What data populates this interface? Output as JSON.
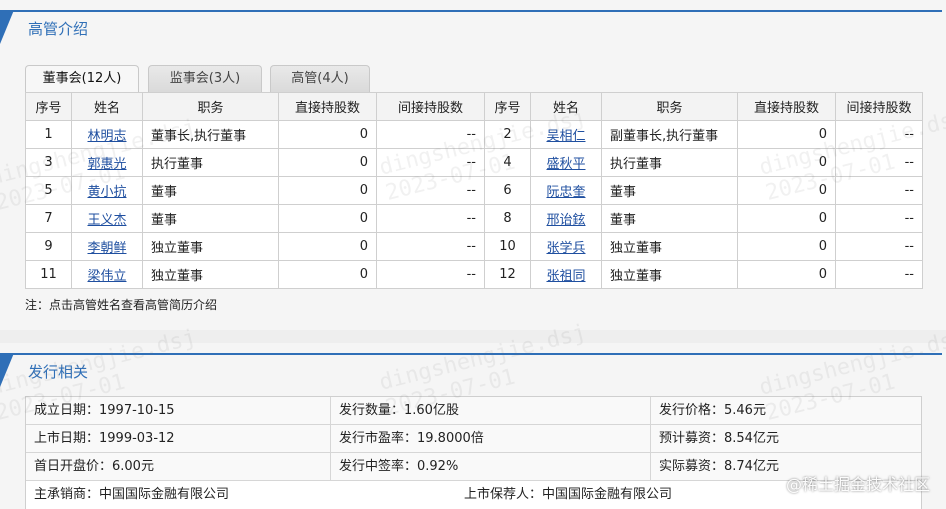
{
  "exec_section": {
    "title": "高管介绍",
    "tabs": [
      {
        "label": "董事会(12人)",
        "active": true
      },
      {
        "label": "监事会(3人)",
        "active": false
      },
      {
        "label": "高管(4人)",
        "active": false
      }
    ],
    "columns": [
      "序号",
      "姓名",
      "职务",
      "直接持股数",
      "间接持股数",
      "序号",
      "姓名",
      "职务",
      "直接持股数",
      "间接持股数"
    ],
    "rows": [
      {
        "l": {
          "no": "1",
          "name": "林明志",
          "title": "董事长,执行董事",
          "direct": "0",
          "indirect": "--"
        },
        "r": {
          "no": "2",
          "name": "吴相仁",
          "title": "副董事长,执行董事",
          "direct": "0",
          "indirect": "--"
        }
      },
      {
        "l": {
          "no": "3",
          "name": "郭惠光",
          "title": "执行董事",
          "direct": "0",
          "indirect": "--"
        },
        "r": {
          "no": "4",
          "name": "盛秋平",
          "title": "执行董事",
          "direct": "0",
          "indirect": "--"
        }
      },
      {
        "l": {
          "no": "5",
          "name": "黄小抗",
          "title": "董事",
          "direct": "0",
          "indirect": "--"
        },
        "r": {
          "no": "6",
          "name": "阮忠奎",
          "title": "董事",
          "direct": "0",
          "indirect": "--"
        }
      },
      {
        "l": {
          "no": "7",
          "name": "王义杰",
          "title": "董事",
          "direct": "0",
          "indirect": "--"
        },
        "r": {
          "no": "8",
          "name": "邢诒鉉",
          "title": "董事",
          "direct": "0",
          "indirect": "--"
        }
      },
      {
        "l": {
          "no": "9",
          "name": "李朝鲜",
          "title": "独立董事",
          "direct": "0",
          "indirect": "--"
        },
        "r": {
          "no": "10",
          "name": "张学兵",
          "title": "独立董事",
          "direct": "0",
          "indirect": "--"
        }
      },
      {
        "l": {
          "no": "11",
          "name": "梁伟立",
          "title": "独立董事",
          "direct": "0",
          "indirect": "--"
        },
        "r": {
          "no": "12",
          "name": "张祖同",
          "title": "独立董事",
          "direct": "0",
          "indirect": "--"
        }
      }
    ],
    "note": "注：点击高管姓名查看高管简历介绍"
  },
  "issue_section": {
    "title": "发行相关",
    "rows": [
      [
        "成立日期：1997-10-15",
        "发行数量：1.60亿股",
        "发行价格：5.46元"
      ],
      [
        "上市日期：1999-03-12",
        "发行市盈率：19.8000倍",
        "预计募资：8.54亿元"
      ],
      [
        "首日开盘价：6.00元",
        "发行中签率：0.92%",
        "实际募资：8.74亿元"
      ]
    ],
    "last_row": [
      "主承销商：中国国际金融有限公司",
      "上市保荐人：中国国际金融有限公司"
    ]
  },
  "watermarks": {
    "text": "dingshengjie.dsj",
    "date": "2023-07-01",
    "corner": "@稀土掘金技术社区"
  },
  "colors": {
    "accent": "#2f6fb7",
    "link": "#1f4fa0"
  }
}
